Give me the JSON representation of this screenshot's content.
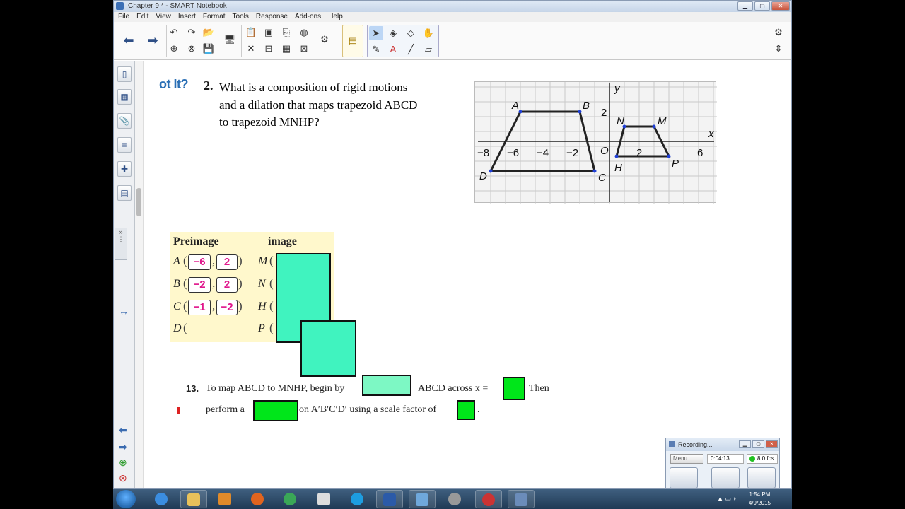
{
  "window": {
    "title": "Chapter 9 * - SMART Notebook"
  },
  "menu": [
    "File",
    "Edit",
    "View",
    "Insert",
    "Format",
    "Tools",
    "Response",
    "Add-ons",
    "Help"
  ],
  "problem": {
    "gotit": "ot It?",
    "number": "2.",
    "lines": [
      "What is a composition of rigid motions",
      "and a dilation that maps trapezoid ABCD",
      "to trapezoid MNHP?"
    ]
  },
  "graph": {
    "x_ticks": [
      "−8",
      "−6",
      "−4",
      "−2",
      "O",
      "2",
      "6"
    ],
    "y_tick": "2",
    "x_axis": "x",
    "y_axis": "y",
    "points": [
      "A",
      "B",
      "C",
      "D",
      "N",
      "M",
      "H",
      "P"
    ]
  },
  "table": {
    "headers": {
      "preimage": "Preimage",
      "image": "image"
    },
    "rows": [
      {
        "pre": "A",
        "x": "−6",
        "y": "2",
        "img": "M"
      },
      {
        "pre": "B",
        "x": "−2",
        "y": "2",
        "img": "N"
      },
      {
        "pre": "C",
        "x": "−1",
        "y": "−2",
        "img": "H"
      },
      {
        "pre": "D",
        "img": "P"
      }
    ]
  },
  "q13": {
    "num": "13.",
    "part1": "To map ABCD to MNHP, begin by",
    "part2": "ABCD across x =",
    "part3": "Then",
    "part4": "perform a",
    "part5": "on A′B′C′D′ using a scale factor of",
    "part6": "."
  },
  "recording": {
    "title": "Recording...",
    "menu": "Menu",
    "time": "0:04:13",
    "fps": "8.0 fps"
  },
  "clock": {
    "time": "1:54 PM",
    "date": "4/9/2015"
  }
}
